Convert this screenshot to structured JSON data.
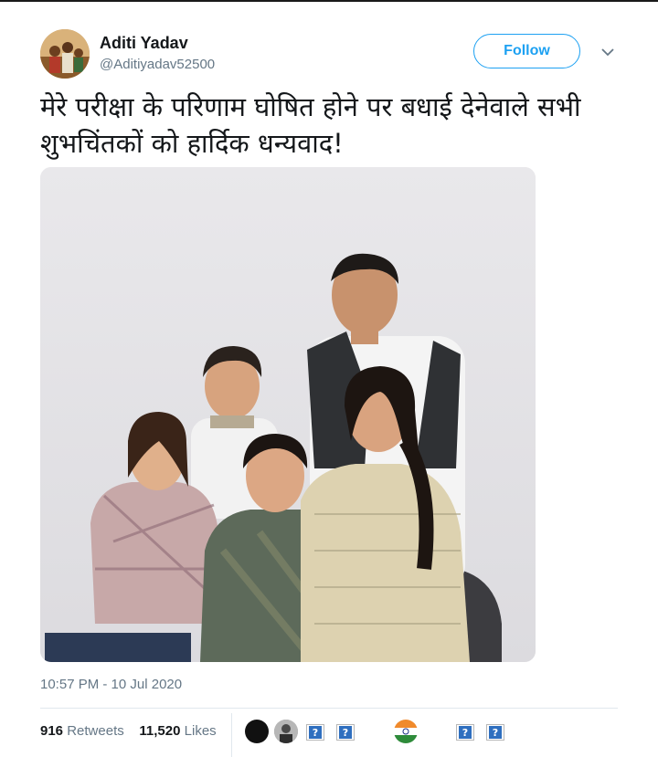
{
  "tweet": {
    "author_name": "Aditi Yadav",
    "author_handle": "@Aditiyadav52500",
    "follow_label": "Follow",
    "text_line_1": "मेरे परीक्षा के परिणाम घोषित होने पर बधाई देनेवाले सभी",
    "text_line_2": "शुभचिंतकों को हार्दिक धन्यवाद!",
    "timestamp": "10:57 PM - 10 Jul 2020",
    "retweets_count": "916",
    "retweets_label": "Retweets",
    "likes_count": "11,520",
    "likes_label": "Likes"
  },
  "icons": {
    "more": "chevron-down-icon",
    "avatar": "profile-avatar",
    "flag": "india-flag-icon",
    "broken": "broken-image-icon"
  },
  "broken_glyph": "?",
  "colors": {
    "accent": "#1da1f2",
    "text": "#14171a",
    "secondary": "#657786"
  }
}
